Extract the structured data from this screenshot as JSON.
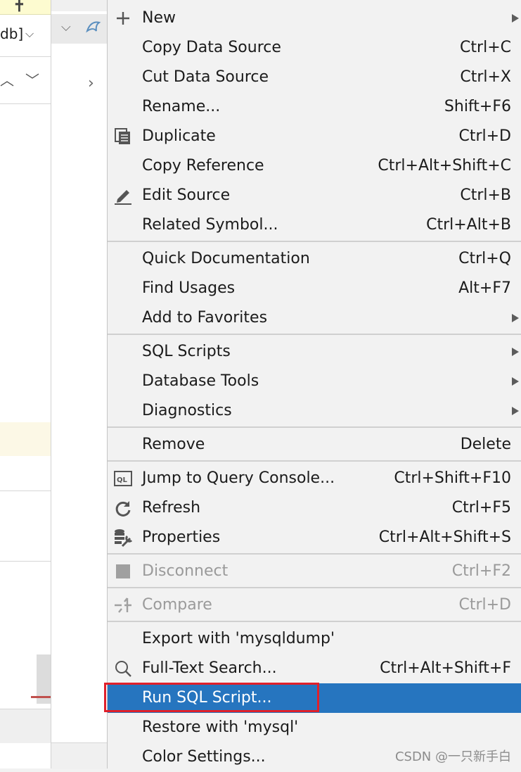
{
  "background": {
    "combo_text": "db]",
    "combo_icon": "chevron-down-icon",
    "nav_up_icon": "chevron-up-icon",
    "nav_down_icon": "chevron-down-icon",
    "tree_expand_icon": "chevron-down-icon",
    "tree_node_icon": "mysql-dolphin-icon",
    "side_arrow_icon": "chevron-right-icon"
  },
  "menu": {
    "items": [
      {
        "label": "New",
        "shortcut": "",
        "icon": "plus-icon",
        "submenu": true,
        "disabled": false
      },
      {
        "label": "Copy Data Source",
        "shortcut": "Ctrl+C",
        "icon": "",
        "submenu": false,
        "disabled": false
      },
      {
        "label": "Cut Data Source",
        "shortcut": "Ctrl+X",
        "icon": "",
        "submenu": false,
        "disabled": false
      },
      {
        "label": "Rename...",
        "shortcut": "Shift+F6",
        "icon": "",
        "submenu": false,
        "disabled": false
      },
      {
        "label": "Duplicate",
        "shortcut": "Ctrl+D",
        "icon": "duplicate-icon",
        "submenu": false,
        "disabled": false
      },
      {
        "label": "Copy Reference",
        "shortcut": "Ctrl+Alt+Shift+C",
        "icon": "",
        "submenu": false,
        "disabled": false
      },
      {
        "label": "Edit Source",
        "shortcut": "Ctrl+B",
        "icon": "pencil-icon",
        "submenu": false,
        "disabled": false
      },
      {
        "label": "Related Symbol...",
        "shortcut": "Ctrl+Alt+B",
        "icon": "",
        "submenu": false,
        "disabled": false
      },
      {
        "label": "Quick Documentation",
        "shortcut": "Ctrl+Q",
        "icon": "",
        "submenu": false,
        "disabled": false
      },
      {
        "label": "Find Usages",
        "shortcut": "Alt+F7",
        "icon": "",
        "submenu": false,
        "disabled": false
      },
      {
        "label": "Add to Favorites",
        "shortcut": "",
        "icon": "",
        "submenu": true,
        "disabled": false
      },
      {
        "label": "SQL Scripts",
        "shortcut": "",
        "icon": "",
        "submenu": true,
        "disabled": false
      },
      {
        "label": "Database Tools",
        "shortcut": "",
        "icon": "",
        "submenu": true,
        "disabled": false
      },
      {
        "label": "Diagnostics",
        "shortcut": "",
        "icon": "",
        "submenu": true,
        "disabled": false
      },
      {
        "label": "Remove",
        "shortcut": "Delete",
        "icon": "",
        "submenu": false,
        "disabled": false
      },
      {
        "label": "Jump to Query Console...",
        "shortcut": "Ctrl+Shift+F10",
        "icon": "query-console-icon",
        "submenu": false,
        "disabled": false
      },
      {
        "label": "Refresh",
        "shortcut": "Ctrl+F5",
        "icon": "refresh-icon",
        "submenu": false,
        "disabled": false
      },
      {
        "label": "Properties",
        "shortcut": "Ctrl+Alt+Shift+S",
        "icon": "properties-icon",
        "submenu": false,
        "disabled": false
      },
      {
        "label": "Disconnect",
        "shortcut": "Ctrl+F2",
        "icon": "stop-icon",
        "submenu": false,
        "disabled": true
      },
      {
        "label": "Compare",
        "shortcut": "Ctrl+D",
        "icon": "compare-icon",
        "submenu": false,
        "disabled": true
      },
      {
        "label": "Export with 'mysqldump'",
        "shortcut": "",
        "icon": "",
        "submenu": false,
        "disabled": false
      },
      {
        "label": "Full-Text Search...",
        "shortcut": "Ctrl+Alt+Shift+F",
        "icon": "search-icon",
        "submenu": false,
        "disabled": false
      },
      {
        "label": "Run SQL Script...",
        "shortcut": "",
        "icon": "",
        "submenu": false,
        "disabled": false,
        "selected": true
      },
      {
        "label": "Restore with 'mysql'",
        "shortcut": "",
        "icon": "",
        "submenu": false,
        "disabled": false
      },
      {
        "label": "Color Settings...",
        "shortcut": "",
        "icon": "",
        "submenu": false,
        "disabled": false
      }
    ]
  },
  "colors": {
    "selection": "#2675bf",
    "highlight_box": "#e0202a",
    "menu_background": "#f2f2f2"
  },
  "watermark": "CSDN @一只新手白"
}
